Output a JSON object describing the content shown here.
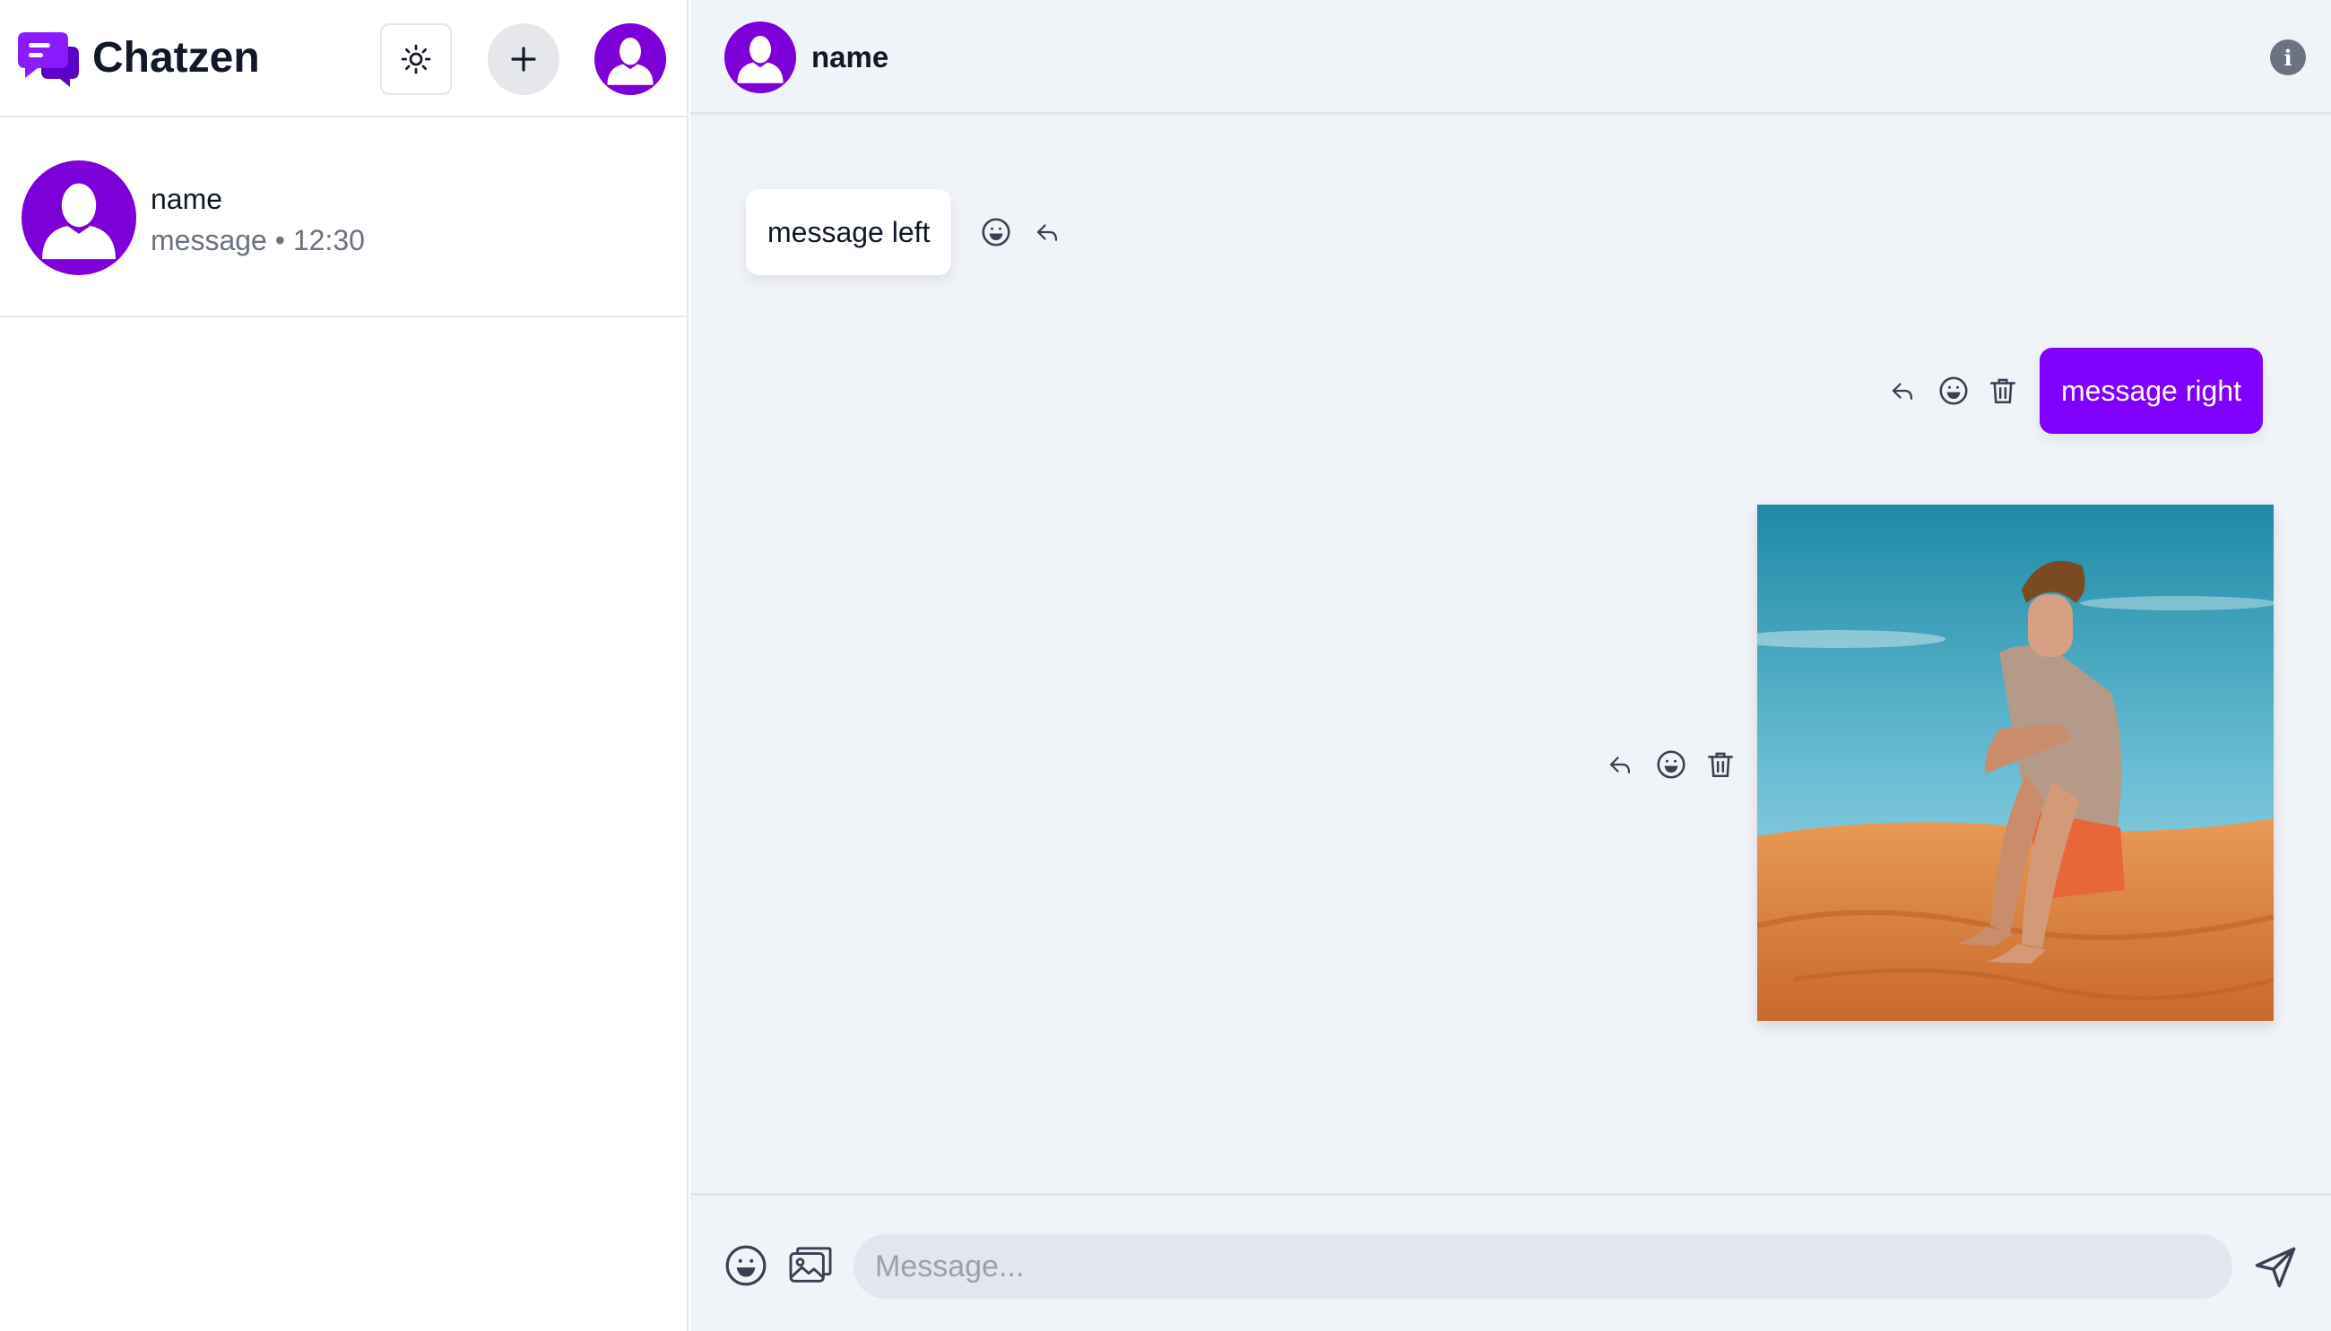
{
  "app": {
    "title": "Chatzen",
    "accent_color": "#7f00ff",
    "avatar_color": "#7c00d8"
  },
  "sidebar": {
    "logo_icon": "chat-bubbles-icon",
    "theme_toggle_icon": "sun-icon",
    "new_chat_icon": "plus-icon",
    "profile_icon": "user-avatar-icon",
    "conversations": [
      {
        "name": "name",
        "last_message": "message",
        "separator": "•",
        "time": "12:30"
      }
    ]
  },
  "chat": {
    "header_name": "name",
    "info_icon": "info-icon",
    "info_label": "i",
    "messages": [
      {
        "side": "left",
        "type": "text",
        "text": "message left",
        "actions": [
          "emoji-icon",
          "reply-icon"
        ]
      },
      {
        "side": "right",
        "type": "text",
        "text": "message right",
        "actions": [
          "reply-icon",
          "emoji-icon",
          "trash-icon"
        ]
      },
      {
        "side": "right",
        "type": "image",
        "image_description_icon": "photo-man-on-sand-dunes",
        "actions": [
          "reply-icon",
          "emoji-icon",
          "trash-icon"
        ]
      }
    ]
  },
  "composer": {
    "placeholder": "Message...",
    "value": "",
    "emoji_icon": "emoji-icon",
    "image_icon": "image-upload-icon",
    "send_icon": "send-icon"
  }
}
